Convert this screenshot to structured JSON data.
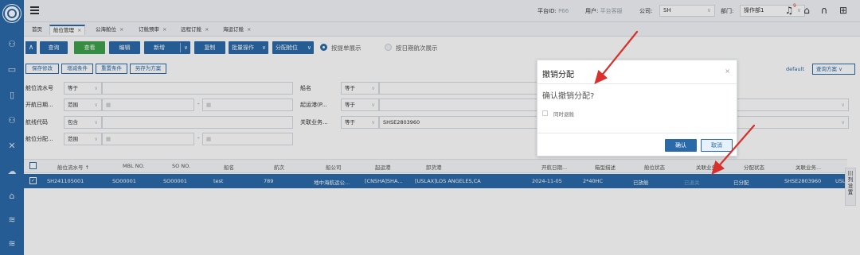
{
  "topbar": {
    "platform_label": "平台ID:",
    "platform_value": "P66",
    "user_label": "用户:",
    "user_value": "平台客服",
    "company_label": "公司:",
    "company_value": "SH",
    "dept_label": "部门:",
    "dept_value": "操作部1",
    "notify_count": "9"
  },
  "tabs": [
    {
      "label": "首页"
    },
    {
      "label": "舱位管理"
    },
    {
      "label": "公海舱位"
    },
    {
      "label": "订舱预审"
    },
    {
      "label": "远程订舱"
    },
    {
      "label": "海运订舱"
    }
  ],
  "toolbar": {
    "query": "查询",
    "view": "查看",
    "edit": "编辑",
    "add": "新增",
    "copy": "复制",
    "batch": "批量操作",
    "allocate": "分配舱位",
    "radio_by_bill": "按提单展示",
    "radio_by_voyage": "按日期航次展示"
  },
  "actions": {
    "save_modify": "保存修改",
    "add_condition": "增减条件",
    "reset_condition": "重置条件",
    "save_as": "另存为方案",
    "default_label": "default",
    "scheme": "查询方案"
  },
  "filters": {
    "row1_label": "舱位流水号",
    "row1_op": "等于",
    "row1_mid_label": "船名",
    "row1_mid_op": "等于",
    "row2_label": "开航日期...",
    "row2_op": "范围",
    "row2_mid_label": "起运港(P...",
    "row2_mid_op": "等于",
    "row3_label": "航线代码",
    "row3_op": "包含",
    "row3_mid_label": "关联业务...",
    "row3_mid_op": "等于",
    "row3_mid_value": "SHSE2803960",
    "row4_label": "舱位分配...",
    "row4_op": "范围",
    "dash": "-"
  },
  "table": {
    "headers": [
      "舱位流水号 ↑",
      "MBL NO.",
      "SO NO.",
      "船名",
      "航次",
      "船公司",
      "起运港",
      "卸货港",
      "开航日期...",
      "箱型描述",
      "舱位状态",
      "关联业务",
      "分配状态",
      "关联业务..."
    ],
    "row": [
      "SH241105001",
      "SO00001",
      "SO00001",
      "test",
      "789",
      "地中海航运公...",
      "[CNSHA]SHA...",
      "[USLAX]LOS ANGELES,CA",
      "2024-11-05",
      "2*40HC",
      "已放舱",
      "已退关",
      "已分配",
      "SHSE2803960",
      "USL"
    ],
    "col_settings": "列设置"
  },
  "dialog": {
    "title": "撤销分配",
    "close": "×",
    "message": "确认撤销分配?",
    "checkbox_label": "同时退舱",
    "ok": "确认",
    "cancel": "取消"
  },
  "colors": {
    "primary": "#2a6aa9",
    "green": "#3fa34b",
    "annotation_red": "#d9302c"
  }
}
